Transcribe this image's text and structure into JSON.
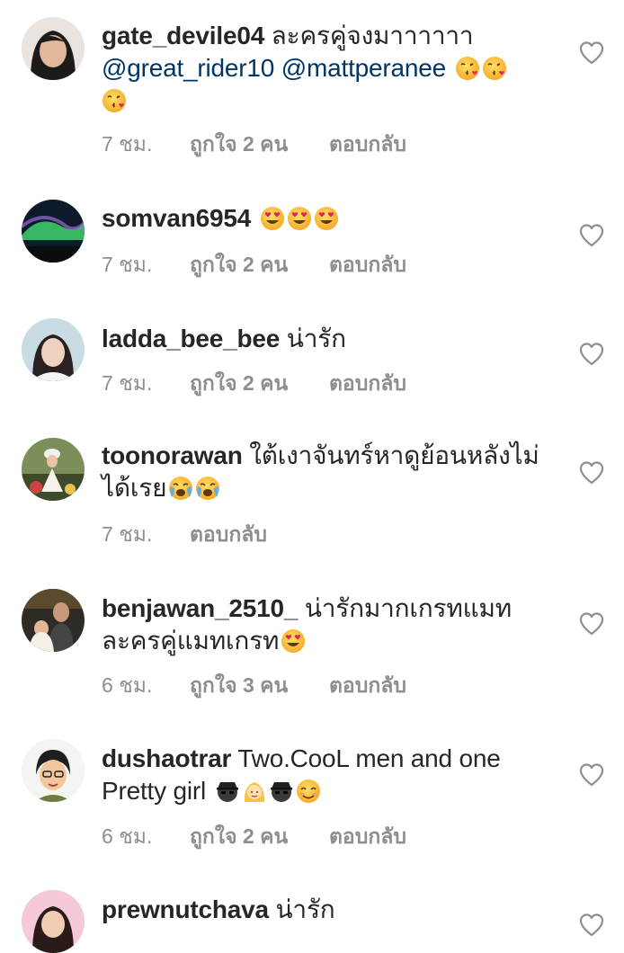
{
  "comments": [
    {
      "username": "gate_devile04",
      "text": "ละครคู่จงมาาาาาา",
      "mentions": [
        "@great_rider10",
        "@mattperanee"
      ],
      "emojis": [
        "kissing-heart",
        "kissing-heart",
        "kissing-heart"
      ],
      "time": "7 ชม.",
      "likes": "ถูกใจ 2 คน",
      "reply": "ตอบกลับ"
    },
    {
      "username": "somvan6954",
      "text": "",
      "emojis": [
        "heart-eyes",
        "heart-eyes",
        "heart-eyes"
      ],
      "time": "7 ชม.",
      "likes": "ถูกใจ 2 คน",
      "reply": "ตอบกลับ"
    },
    {
      "username": "ladda_bee_bee",
      "text": "น่ารัก",
      "time": "7 ชม.",
      "likes": "ถูกใจ 2 คน",
      "reply": "ตอบกลับ"
    },
    {
      "username": "toonorawan",
      "text": "ใต้เงาจันทร์หาดูย้อนหลังไม่ได้เรย",
      "emojis": [
        "loudly-crying",
        "loudly-crying"
      ],
      "time": "7 ชม.",
      "reply": "ตอบกลับ"
    },
    {
      "username": "benjawan_2510_",
      "text": "น่ารักมากเกรทแมท ละครคู่แมทเกรท",
      "emojis": [
        "heart-eyes"
      ],
      "time": "6 ชม.",
      "likes": "ถูกใจ 3 คน",
      "reply": "ตอบกลับ"
    },
    {
      "username": "dushaotrar",
      "text": "Two.CooL men and one Pretty girl",
      "emojis": [
        "spy",
        "woman-blonde",
        "spy",
        "smiling"
      ],
      "time": "6 ชม.",
      "likes": "ถูกใจ 2 คน",
      "reply": "ตอบกลับ"
    },
    {
      "username": "prewnutchava",
      "text": "น่ารัก"
    }
  ],
  "icons": {
    "like": "heart-outline-icon"
  },
  "colors": {
    "username": "#262626",
    "mention": "#003569",
    "meta": "#8e8e8e"
  }
}
